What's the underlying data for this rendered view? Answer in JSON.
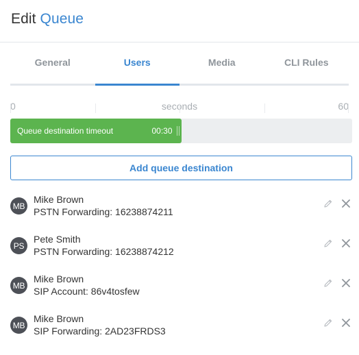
{
  "header": {
    "title_prefix": "Edit",
    "title_accent": "Queue"
  },
  "tabs": [
    {
      "label": "General",
      "active": false
    },
    {
      "label": "Users",
      "active": true
    },
    {
      "label": "Media",
      "active": false
    },
    {
      "label": "CLI Rules",
      "active": false
    }
  ],
  "timeline": {
    "min_label": "0",
    "unit_label": "seconds",
    "max_label": "60",
    "bar": {
      "label": "Queue destination timeout",
      "time": "00:30",
      "value_seconds": 30,
      "max_seconds": 60,
      "color": "#5cb44f"
    }
  },
  "add_button": {
    "label": "Add queue destination"
  },
  "users": [
    {
      "initials": "MB",
      "name": "Mike Brown",
      "detail": "PSTN Forwarding: 16238874211"
    },
    {
      "initials": "PS",
      "name": "Pete Smith",
      "detail": "PSTN Forwarding: 16238874212"
    },
    {
      "initials": "MB",
      "name": "Mike Brown",
      "detail": "SIP Account: 86v4tosfew"
    },
    {
      "initials": "MB",
      "name": "Mike Brown",
      "detail": "SIP Forwarding: 2AD23FRDS3"
    }
  ],
  "icons": {
    "edit": "pencil-icon",
    "remove": "close-icon"
  },
  "colors": {
    "accent": "#3a86d0",
    "bar": "#5cb44f",
    "avatar": "#4d5057"
  }
}
